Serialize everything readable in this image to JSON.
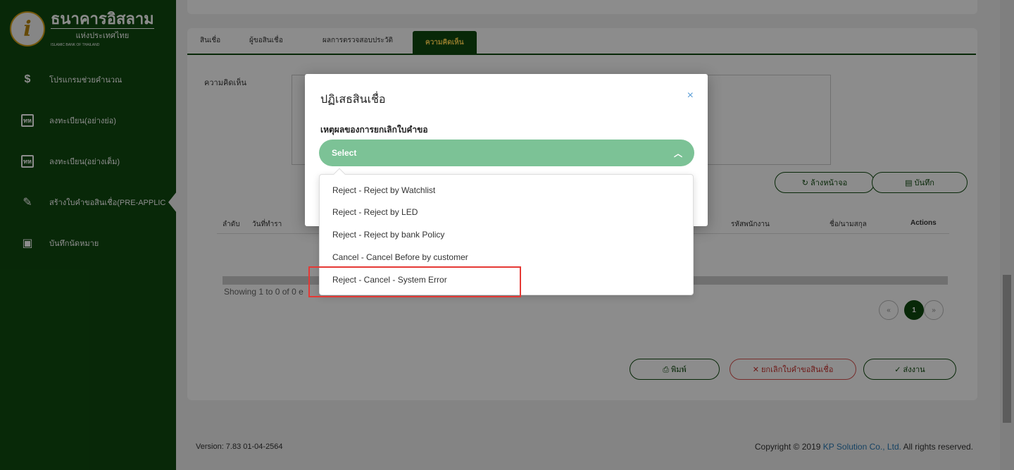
{
  "sidebar": {
    "logo": {
      "mark": "i",
      "name_th": "ธนาคารอิสลาม",
      "sub_th": "แห่งประเทศไทย",
      "name_en": "ISLAMIC BANK OF THAILAND"
    },
    "items": [
      {
        "icon": "dollar-icon",
        "glyph": "$",
        "label": "โปรแกรมช่วยคำนวณ"
      },
      {
        "icon": "register-icon",
        "glyph": "ทห",
        "label": "ลงทะเบียน(อย่างย่อ)"
      },
      {
        "icon": "register-full-icon",
        "glyph": "ทห",
        "label": "ลงทะเบียน(อย่างเต็ม)"
      },
      {
        "icon": "pencil-icon",
        "glyph": "✎",
        "label": "สร้างใบคำขอสินเชื่อ(PRE-APPLIC"
      },
      {
        "icon": "calendar-icon",
        "glyph": "▣",
        "label": "บันทึกนัดหมาย"
      }
    ]
  },
  "tabs": [
    {
      "label": "สินเชื่อ"
    },
    {
      "label": "ผู้ขอสินเชื่อ"
    },
    {
      "label": "ผลการตรวจสอบประวัติ"
    },
    {
      "label": "ความคิดเห็น"
    }
  ],
  "comment_label": "ความคิดเห็น",
  "buttons": {
    "clear": "↻ ล้างหน้าจอ",
    "save": "▤ บันทึก",
    "print": "⎙ พิมพ์",
    "cancel_app": "✕ ยกเลิกใบคำขอสินเชื่อ",
    "submit": "✓ ส่งงาน"
  },
  "table": {
    "headers": [
      "ลำดับ",
      "วันที่ทำรา",
      "รหัสพนักงาน",
      "ชื่อ/นามสกุล",
      "Actions"
    ],
    "showing": "Showing 1 to 0 of 0 e"
  },
  "pagination": {
    "prev": "«",
    "current": "1",
    "next": "»"
  },
  "footer": {
    "version": "Version: 7.83 01-04-2564",
    "copyright_prefix": "Copyright © 2019 ",
    "company": "KP Solution Co., Ltd.",
    "copyright_suffix": " All rights reserved."
  },
  "modal": {
    "title": "ปฏิเสธสินเชื่อ",
    "close": "×",
    "field_label": "เหตุผลของการยกเลิกใบคำขอ",
    "select_value": "Select",
    "options": [
      "Reject - Reject by Watchlist",
      "Reject - Reject by LED",
      "Reject - Reject by bank Policy",
      "Cancel - Cancel Before by customer",
      "Reject - Cancel - System Error"
    ]
  }
}
